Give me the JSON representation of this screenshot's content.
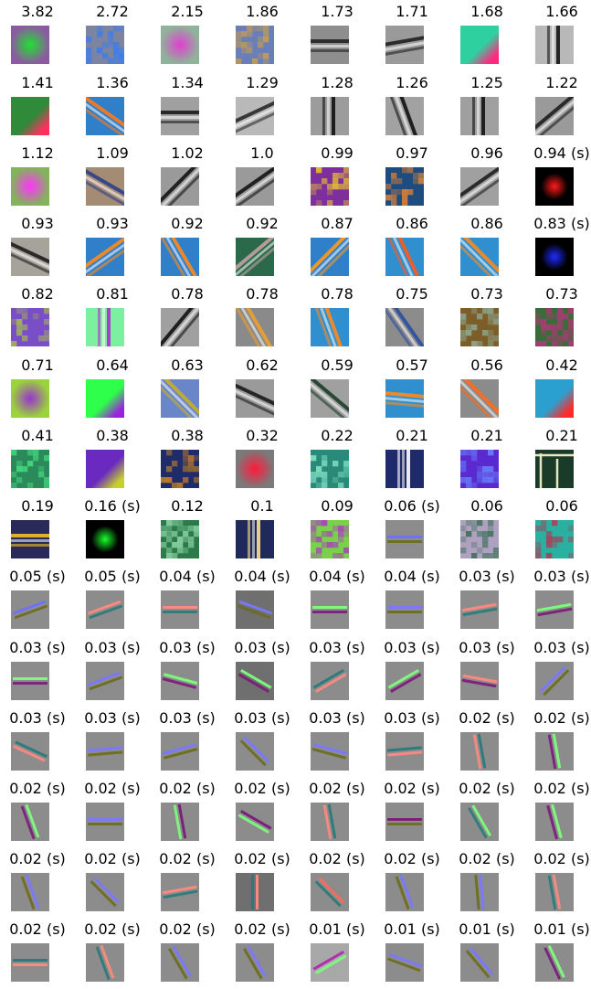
{
  "figure": {
    "columns": 8,
    "rows": 14,
    "filters": [
      {
        "label": "3.82",
        "kind": "blob",
        "bg": "#8c5aa0",
        "fg": "#1fe02f"
      },
      {
        "label": "2.72",
        "kind": "noise",
        "bg": "#7c84a0",
        "fg": "#2f7cff"
      },
      {
        "label": "2.15",
        "kind": "blob",
        "bg": "#8fb39a",
        "fg": "#e040d0"
      },
      {
        "label": "1.86",
        "kind": "noise",
        "bg": "#6a7fb8",
        "fg": "#d7a23a"
      },
      {
        "label": "1.73",
        "kind": "stripes",
        "bg": "#8e8e8e",
        "fg": "#222222",
        "angle": 0
      },
      {
        "label": "1.71",
        "kind": "stripes",
        "bg": "#9a9a9a",
        "fg": "#202020",
        "angle": -10
      },
      {
        "label": "1.68",
        "kind": "edge",
        "bg": "#2fd0a0",
        "fg": "#ff2a80"
      },
      {
        "label": "1.66",
        "kind": "stripes",
        "bg": "#b8b8b8",
        "fg": "#151515",
        "angle": 90
      },
      {
        "label": "1.41",
        "kind": "edge",
        "bg": "#2f8a3a",
        "fg": "#ff3060"
      },
      {
        "label": "1.36",
        "kind": "stripes",
        "bg": "#2f7fc9",
        "fg": "#ff7a1a",
        "angle": 35
      },
      {
        "label": "1.34",
        "kind": "stripes",
        "bg": "#a0a0a0",
        "fg": "#1b1b1b",
        "angle": 0
      },
      {
        "label": "1.29",
        "kind": "stripes",
        "bg": "#b9b9b9",
        "fg": "#2a2a2a",
        "angle": -25
      },
      {
        "label": "1.28",
        "kind": "stripes",
        "bg": "#9c9c9c",
        "fg": "#111111",
        "angle": 90
      },
      {
        "label": "1.26",
        "kind": "stripes",
        "bg": "#a2a2a2",
        "fg": "#111111",
        "angle": 70
      },
      {
        "label": "1.25",
        "kind": "stripes",
        "bg": "#9f9f9f",
        "fg": "#111111",
        "angle": 90
      },
      {
        "label": "1.22",
        "kind": "stripes",
        "bg": "#9a9a9a",
        "fg": "#1e1e1e",
        "angle": -40
      },
      {
        "label": "1.12",
        "kind": "blob",
        "bg": "#83b35a",
        "fg": "#ff33ff"
      },
      {
        "label": "1.09",
        "kind": "stripes",
        "bg": "#a48b74",
        "fg": "#2d3f8c",
        "angle": 30
      },
      {
        "label": "1.02",
        "kind": "stripes",
        "bg": "#9a9a9a",
        "fg": "#141414",
        "angle": -45
      },
      {
        "label": "1.0",
        "kind": "stripes",
        "bg": "#9a9a9a",
        "fg": "#141414",
        "angle": -35
      },
      {
        "label": "0.99",
        "kind": "noise",
        "bg": "#7d2f9d",
        "fg": "#f5d31f"
      },
      {
        "label": "0.97",
        "kind": "noise",
        "bg": "#1f4c7f",
        "fg": "#ff8a2a"
      },
      {
        "label": "0.96",
        "kind": "stripes",
        "bg": "#a0a0a0",
        "fg": "#1e1e1e",
        "angle": -35
      },
      {
        "label": "0.94 (s)",
        "kind": "dot",
        "bg": "#000000",
        "fg": "#ff1a1a"
      },
      {
        "label": "0.93",
        "kind": "stripes",
        "bg": "#a6a39b",
        "fg": "#1d1d1d",
        "angle": 25
      },
      {
        "label": "0.93",
        "kind": "stripes",
        "bg": "#2f7fc9",
        "fg": "#ff8a1a",
        "angle": -35
      },
      {
        "label": "0.92",
        "kind": "stripes",
        "bg": "#2f7fc9",
        "fg": "#ff8a1a",
        "angle": 60
      },
      {
        "label": "0.92",
        "kind": "stripes",
        "bg": "#2a6a4a",
        "fg": "#c7a0a0",
        "angle": -40
      },
      {
        "label": "0.87",
        "kind": "stripes",
        "bg": "#2f7fc9",
        "fg": "#ff9a1a",
        "angle": -45
      },
      {
        "label": "0.86",
        "kind": "stripes",
        "bg": "#2f8fcf",
        "fg": "#ff5a1a",
        "angle": 65
      },
      {
        "label": "0.86",
        "kind": "stripes",
        "bg": "#2f8fcf",
        "fg": "#ff8a1a",
        "angle": 45
      },
      {
        "label": "0.83 (s)",
        "kind": "dot",
        "bg": "#000000",
        "fg": "#1f2bff"
      },
      {
        "label": "0.82",
        "kind": "noise",
        "bg": "#7a4ec6",
        "fg": "#a9c24a"
      },
      {
        "label": "0.81",
        "kind": "stripes",
        "bg": "#7df0a0",
        "fg": "#b02bd0",
        "angle": 90
      },
      {
        "label": "0.78",
        "kind": "stripes",
        "bg": "#a0a0a0",
        "fg": "#111111",
        "angle": -50
      },
      {
        "label": "0.78",
        "kind": "stripes",
        "bg": "#8a8a8a",
        "fg": "#f0a02a",
        "angle": 60
      },
      {
        "label": "0.78",
        "kind": "stripes",
        "bg": "#2f8fcf",
        "fg": "#ff8a1a",
        "angle": 70
      },
      {
        "label": "0.75",
        "kind": "stripes",
        "bg": "#8c8c8c",
        "fg": "#2a4ea0",
        "angle": 55
      },
      {
        "label": "0.73",
        "kind": "noise",
        "bg": "#7e5e28",
        "fg": "#8fb3a3"
      },
      {
        "label": "0.73",
        "kind": "noise",
        "bg": "#3a6c39",
        "fg": "#c03080"
      },
      {
        "label": "0.71",
        "kind": "blob",
        "bg": "#9ad43a",
        "fg": "#9a33d0"
      },
      {
        "label": "0.64",
        "kind": "edge",
        "bg": "#2eff4a",
        "fg": "#9a22dd"
      },
      {
        "label": "0.63",
        "kind": "stripes",
        "bg": "#6a86c8",
        "fg": "#c7b022",
        "angle": 45
      },
      {
        "label": "0.62",
        "kind": "stripes",
        "bg": "#9a9a9a",
        "fg": "#1a1a1a",
        "angle": 25
      },
      {
        "label": "0.59",
        "kind": "stripes",
        "bg": "#a0a0a0",
        "fg": "#1b3e28",
        "angle": 40
      },
      {
        "label": "0.57",
        "kind": "stripes",
        "bg": "#2f8fcf",
        "fg": "#ff8a1a",
        "angle": 5
      },
      {
        "label": "0.56",
        "kind": "stripes",
        "bg": "#8b8b8b",
        "fg": "#ff6a1a",
        "angle": 45
      },
      {
        "label": "0.42",
        "kind": "edge",
        "bg": "#2aa0d0",
        "fg": "#ff2a2a"
      },
      {
        "label": "0.41",
        "kind": "noise",
        "bg": "#2a8a5a",
        "fg": "#4cf08a"
      },
      {
        "label": "0.38",
        "kind": "edge",
        "bg": "#6a2ac0",
        "fg": "#c5d02a"
      },
      {
        "label": "0.38",
        "kind": "noise",
        "bg": "#1f2c6a",
        "fg": "#e08a1a"
      },
      {
        "label": "0.32",
        "kind": "blob",
        "bg": "#7a7a7a",
        "fg": "#ff1a3a"
      },
      {
        "label": "0.22",
        "kind": "noise",
        "bg": "#2a8a7a",
        "fg": "#8ff0d0"
      },
      {
        "label": "0.21",
        "kind": "stripes",
        "bg": "#1f2a6a",
        "fg": "#ffffff",
        "angle": 90
      },
      {
        "label": "0.21",
        "kind": "noise",
        "bg": "#5a2ad0",
        "fg": "#6a8aff"
      },
      {
        "label": "0.21",
        "kind": "frame",
        "bg": "#1a3a2a",
        "fg": "#e7e7c0"
      },
      {
        "label": "0.19",
        "kind": "stripes",
        "bg": "#2a2a5a",
        "fg": "#f0c02a",
        "angle": 0
      },
      {
        "label": "0.16 (s)",
        "kind": "dot",
        "bg": "#000000",
        "fg": "#1aff2a"
      },
      {
        "label": "0.12",
        "kind": "noise",
        "bg": "#2a7a4a",
        "fg": "#9ae0b0"
      },
      {
        "label": "0.1",
        "kind": "stripes",
        "bg": "#1f2a5a",
        "fg": "#ffe08a",
        "angle": 90
      },
      {
        "label": "0.09",
        "kind": "noise",
        "bg": "#7ad04a",
        "fg": "#b02ad0"
      },
      {
        "label": "0.06 (s)",
        "kind": "lines",
        "bg": "#8c8c8c",
        "fg": "#6a72ff",
        "fg2": "#6b6b1a",
        "angle": 0
      },
      {
        "label": "0.06",
        "kind": "noise",
        "bg": "#b0a0c0",
        "fg": "#2a6a4a"
      },
      {
        "label": "0.06",
        "kind": "noise",
        "bg": "#2ab0a0",
        "fg": "#c02a4a"
      },
      {
        "label": "0.05 (s)",
        "kind": "lines",
        "bg": "#8c8c8c",
        "fg": "#6a72ff",
        "fg2": "#6b6b1a",
        "angle": -20
      },
      {
        "label": "0.05 (s)",
        "kind": "lines",
        "bg": "#8c8c8c",
        "fg": "#ff8a80",
        "fg2": "#2a7a7a",
        "angle": -20
      },
      {
        "label": "0.04 (s)",
        "kind": "lines",
        "bg": "#8c8c8c",
        "fg": "#ff8a80",
        "fg2": "#2a7a7a",
        "angle": 0
      },
      {
        "label": "0.04 (s)",
        "kind": "lines",
        "bg": "#6f6f6f",
        "fg": "#7a78ff",
        "fg2": "#6b6b1a",
        "angle": 20
      },
      {
        "label": "0.04 (s)",
        "kind": "lines",
        "bg": "#8c8c8c",
        "fg": "#7dff7a",
        "fg2": "#7a1a7a",
        "angle": 0
      },
      {
        "label": "0.04 (s)",
        "kind": "lines",
        "bg": "#8c8c8c",
        "fg": "#7a78ff",
        "fg2": "#6b6b1a",
        "angle": 0
      },
      {
        "label": "0.03 (s)",
        "kind": "lines",
        "bg": "#8c8c8c",
        "fg": "#ff8a80",
        "fg2": "#2a7a7a",
        "angle": -10
      },
      {
        "label": "0.03 (s)",
        "kind": "lines",
        "bg": "#8c8c8c",
        "fg": "#7dff7a",
        "fg2": "#7a1a7a",
        "angle": -10
      },
      {
        "label": "0.03 (s)",
        "kind": "lines",
        "bg": "#8c8c8c",
        "fg": "#7dff7a",
        "fg2": "#7a1a7a",
        "angle": 0
      },
      {
        "label": "0.03 (s)",
        "kind": "lines",
        "bg": "#8c8c8c",
        "fg": "#7a78ff",
        "fg2": "#6b6b1a",
        "angle": -20
      },
      {
        "label": "0.03 (s)",
        "kind": "lines",
        "bg": "#8c8c8c",
        "fg": "#7dff7a",
        "fg2": "#7a1a7a",
        "angle": 15
      },
      {
        "label": "0.03 (s)",
        "kind": "lines",
        "bg": "#6f6f6f",
        "fg": "#7dff7a",
        "fg2": "#7a1a7a",
        "angle": 30
      },
      {
        "label": "0.03 (s)",
        "kind": "lines",
        "bg": "#8c8c8c",
        "fg": "#2a7a7a",
        "fg2": "#ff8a80",
        "angle": -30
      },
      {
        "label": "0.03 (s)",
        "kind": "lines",
        "bg": "#8c8c8c",
        "fg": "#7dff7a",
        "fg2": "#7a1a7a",
        "angle": -30
      },
      {
        "label": "0.03 (s)",
        "kind": "lines",
        "bg": "#8c8c8c",
        "fg": "#ff8a80",
        "fg2": "#7a1a7a",
        "angle": 10
      },
      {
        "label": "0.03 (s)",
        "kind": "lines",
        "bg": "#8c8c8c",
        "fg": "#7a78ff",
        "fg2": "#6b6b1a",
        "angle": -45
      },
      {
        "label": "0.03 (s)",
        "kind": "lines",
        "bg": "#8c8c8c",
        "fg": "#2a7a7a",
        "fg2": "#ff8a80",
        "angle": 25
      },
      {
        "label": "0.03 (s)",
        "kind": "lines",
        "bg": "#8c8c8c",
        "fg": "#7a78ff",
        "fg2": "#6b6b1a",
        "angle": -5
      },
      {
        "label": "0.03 (s)",
        "kind": "lines",
        "bg": "#8c8c8c",
        "fg": "#7a78ff",
        "fg2": "#6b6b1a",
        "angle": -15
      },
      {
        "label": "0.03 (s)",
        "kind": "lines",
        "bg": "#8c8c8c",
        "fg": "#7a78ff",
        "fg2": "#6b6b1a",
        "angle": 45
      },
      {
        "label": "0.03 (s)",
        "kind": "lines",
        "bg": "#8c8c8c",
        "fg": "#7a78ff",
        "fg2": "#6b6b1a",
        "angle": 15
      },
      {
        "label": "0.03 (s)",
        "kind": "lines",
        "bg": "#8c8c8c",
        "fg": "#2a7a7a",
        "fg2": "#ff8a80",
        "angle": -5
      },
      {
        "label": "0.02 (s)",
        "kind": "lines",
        "bg": "#8c8c8c",
        "fg": "#2a7a7a",
        "fg2": "#ff8a80",
        "angle": 80
      },
      {
        "label": "0.02 (s)",
        "kind": "lines",
        "bg": "#8c8c8c",
        "fg": "#7dff7a",
        "fg2": "#7a1a7a",
        "angle": 80
      },
      {
        "label": "0.02 (s)",
        "kind": "lines",
        "bg": "#8c8c8c",
        "fg": "#7dff7a",
        "fg2": "#7a1a7a",
        "angle": 70
      },
      {
        "label": "0.02 (s)",
        "kind": "lines",
        "bg": "#8c8c8c",
        "fg": "#7a78ff",
        "fg2": "#6b6b1a",
        "angle": 0
      },
      {
        "label": "0.02 (s)",
        "kind": "lines",
        "bg": "#8c8c8c",
        "fg": "#7a1a7a",
        "fg2": "#7dff7a",
        "angle": 80
      },
      {
        "label": "0.02 (s)",
        "kind": "lines",
        "bg": "#8c8c8c",
        "fg": "#7a1a7a",
        "fg2": "#7dff7a",
        "angle": 30
      },
      {
        "label": "0.02 (s)",
        "kind": "lines",
        "bg": "#8c8c8c",
        "fg": "#2a7a7a",
        "fg2": "#ff8a80",
        "angle": 80
      },
      {
        "label": "0.02 (s)",
        "kind": "lines",
        "bg": "#8c8c8c",
        "fg": "#7a1a7a",
        "fg2": "#6b6b1a",
        "angle": 0
      },
      {
        "label": "0.02 (s)",
        "kind": "lines",
        "bg": "#8c8c8c",
        "fg": "#7dff7a",
        "fg2": "#2a7a7a",
        "angle": 60
      },
      {
        "label": "0.02 (s)",
        "kind": "lines",
        "bg": "#8c8c8c",
        "fg": "#7dff7a",
        "fg2": "#7a1a7a",
        "angle": 75
      },
      {
        "label": "0.02 (s)",
        "kind": "lines",
        "bg": "#8c8c8c",
        "fg": "#7a78ff",
        "fg2": "#6b6b1a",
        "angle": 70
      },
      {
        "label": "0.02 (s)",
        "kind": "lines",
        "bg": "#8c8c8c",
        "fg": "#7a78ff",
        "fg2": "#6b6b1a",
        "angle": 45
      },
      {
        "label": "0.02 (s)",
        "kind": "lines",
        "bg": "#8c8c8c",
        "fg": "#ff8a80",
        "fg2": "#2a7a7a",
        "angle": -10
      },
      {
        "label": "0.02 (s)",
        "kind": "lines",
        "bg": "#6f6f6f",
        "fg": "#ff8a80",
        "fg2": "#2a7a7a",
        "angle": 90
      },
      {
        "label": "0.02 (s)",
        "kind": "lines",
        "bg": "#8c8c8c",
        "fg": "#ff6a5a",
        "fg2": "#2a7a7a",
        "angle": 45
      },
      {
        "label": "0.02 (s)",
        "kind": "lines",
        "bg": "#8c8c8c",
        "fg": "#7a78ff",
        "fg2": "#6b6b1a",
        "angle": 70
      },
      {
        "label": "0.02 (s)",
        "kind": "lines",
        "bg": "#8c8c8c",
        "fg": "#7a78ff",
        "fg2": "#6b6b1a",
        "angle": 85
      },
      {
        "label": "0.02 (s)",
        "kind": "lines",
        "bg": "#8c8c8c",
        "fg": "#ff8a80",
        "fg2": "#2a7a7a",
        "angle": 80
      },
      {
        "label": "0.02 (s)",
        "kind": "lines",
        "bg": "#8c8c8c",
        "fg": "#2a7a7a",
        "fg2": "#ff8a80",
        "angle": 0
      },
      {
        "label": "0.02 (s)",
        "kind": "lines",
        "bg": "#8c8c8c",
        "fg": "#ff8a80",
        "fg2": "#2a7a7a",
        "angle": 70
      },
      {
        "label": "0.02 (s)",
        "kind": "lines",
        "bg": "#8c8c8c",
        "fg": "#7a78ff",
        "fg2": "#6b6b1a",
        "angle": 60
      },
      {
        "label": "0.02 (s)",
        "kind": "lines",
        "bg": "#8c8c8c",
        "fg": "#7a78ff",
        "fg2": "#6b6b1a",
        "angle": 60
      },
      {
        "label": "0.01 (s)",
        "kind": "lines",
        "bg": "#a8a8a8",
        "fg": "#b02ab0",
        "fg2": "#7dff7a",
        "angle": -30
      },
      {
        "label": "0.01 (s)",
        "kind": "lines",
        "bg": "#8c8c8c",
        "fg": "#7a78ff",
        "fg2": "#6b6b1a",
        "angle": 20
      },
      {
        "label": "0.01 (s)",
        "kind": "lines",
        "bg": "#8c8c8c",
        "fg": "#7a78ff",
        "fg2": "#6b6b1a",
        "angle": 50
      },
      {
        "label": "0.01 (s)",
        "kind": "lines",
        "bg": "#8c8c8c",
        "fg": "#7dff7a",
        "fg2": "#7a1a7a",
        "angle": 65
      }
    ]
  }
}
